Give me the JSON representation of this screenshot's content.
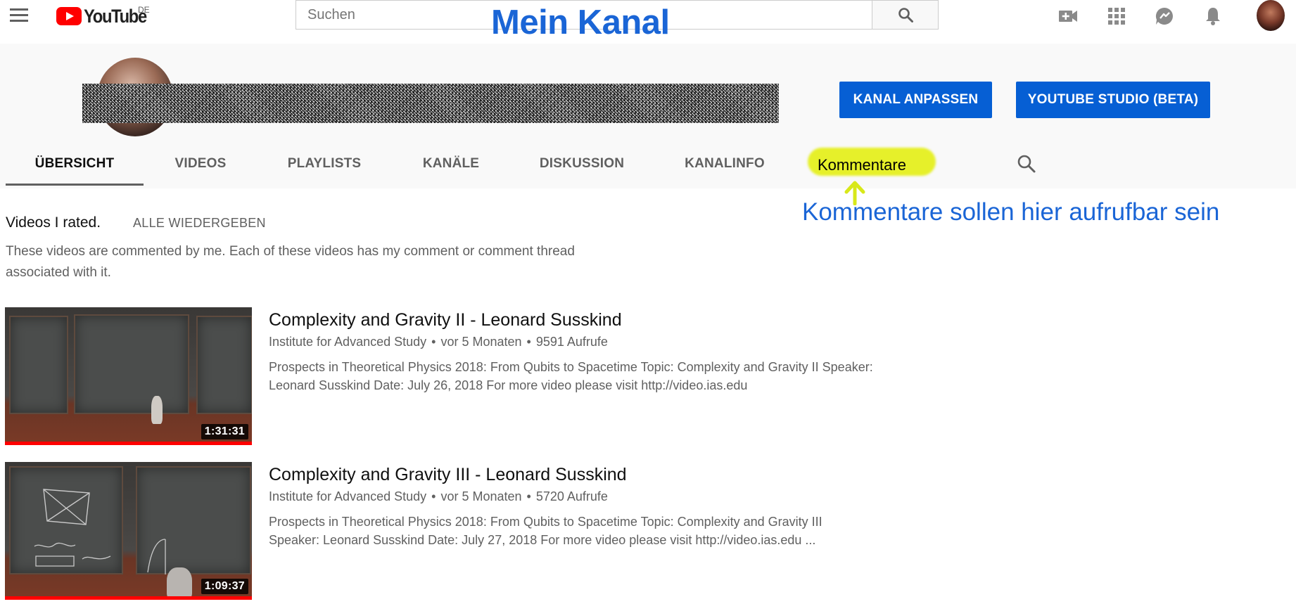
{
  "header": {
    "logo_text": "YouTube",
    "logo_country": "DE",
    "search_placeholder": "Suchen",
    "annotation_title": "Mein Kanal",
    "icons": [
      "menu-icon",
      "search-icon",
      "create-video-icon",
      "apps-grid-icon",
      "messages-icon",
      "notifications-bell-icon",
      "account-avatar"
    ]
  },
  "channel": {
    "customize_label": "KANAL ANPASSEN",
    "studio_label": "YOUTUBE STUDIO (BETA)",
    "tabs": [
      {
        "label": "ÜBERSICHT",
        "active": true
      },
      {
        "label": "VIDEOS"
      },
      {
        "label": "PLAYLISTS"
      },
      {
        "label": "KANÄLE"
      },
      {
        "label": "DISKUSSION"
      },
      {
        "label": "KANALINFO"
      }
    ],
    "kommentare_tab": "Kommentare",
    "annotation_note": "Kommentare sollen hier aufrufbar sein"
  },
  "section": {
    "title": "Videos I rated.",
    "play_all": "ALLE WIEDERGEBEN",
    "description": "These videos are commented by me. Each of these videos has my comment or comment thread associated with it."
  },
  "videos": [
    {
      "title": "Complexity and Gravity II - Leonard Susskind",
      "channel": "Institute for Advanced Study",
      "age": "vor 5 Monaten",
      "views": "9591 Aufrufe",
      "description": "Prospects in Theoretical Physics 2018: From Qubits to Spacetime Topic: Complexity and Gravity II Speaker: Leonard Susskind Date: July 26, 2018 For more video please visit http://video.ias.edu",
      "duration": "1:31:31",
      "watched_fraction": 1.0
    },
    {
      "title": "Complexity and Gravity III - Leonard Susskind",
      "channel": "Institute for Advanced Study",
      "age": "vor 5 Monaten",
      "views": "5720 Aufrufe",
      "description": "Prospects in Theoretical Physics 2018: From Qubits to Spacetime Topic: Complexity and Gravity III Speaker: Leonard Susskind Date: July 27, 2018 For more video please visit http://video.ias.edu ...",
      "duration": "1:09:37",
      "watched_fraction": 1.0
    }
  ],
  "colors": {
    "accent_blue": "#065fd4",
    "annotation_blue": "#1a65d6",
    "highlight_yellow": "#e6f02a",
    "brand_red": "#ff0000"
  }
}
